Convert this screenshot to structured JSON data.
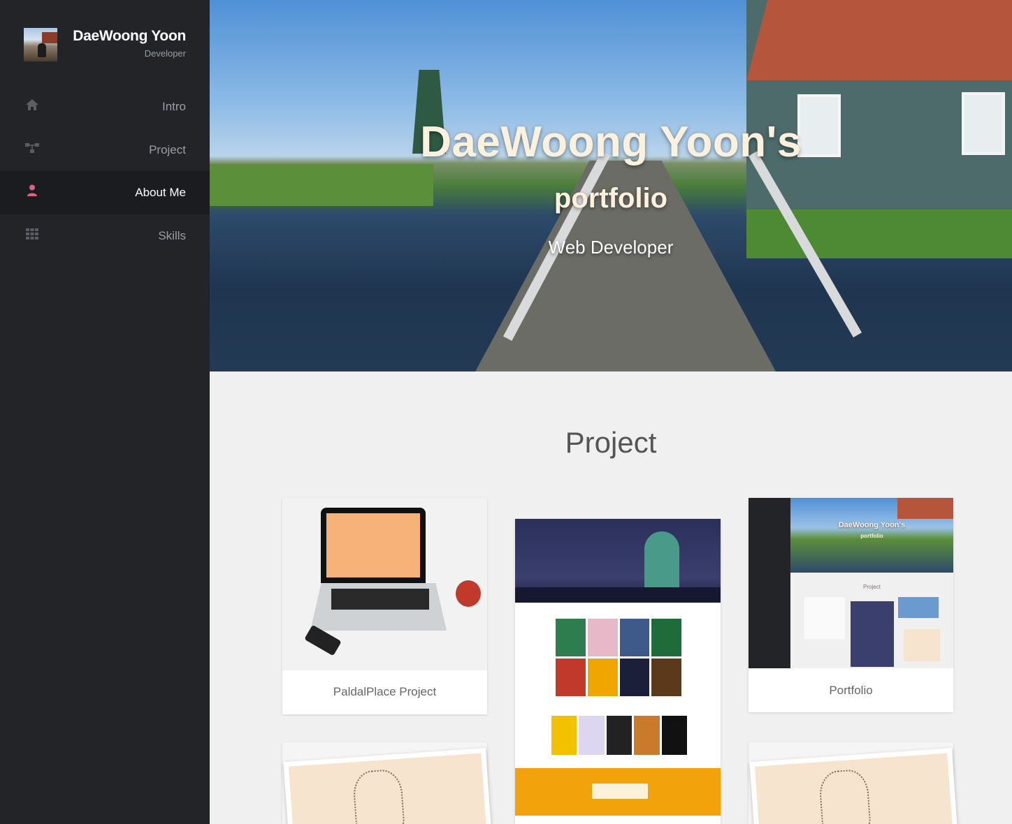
{
  "sidebar": {
    "profile": {
      "name": "DaeWoong Yoon",
      "role": "Developer"
    },
    "items": [
      {
        "label": "Intro",
        "icon": "home-icon",
        "active": false
      },
      {
        "label": "Project",
        "icon": "sitemap-icon",
        "active": false
      },
      {
        "label": "About Me",
        "icon": "user-icon",
        "active": true
      },
      {
        "label": "Skills",
        "icon": "grid-icon",
        "active": false
      }
    ]
  },
  "hero": {
    "title_line1": "DaeWoong Yoon's",
    "title_line2": "portfolio",
    "subtitle": "Web Developer"
  },
  "project": {
    "heading": "Project",
    "cards": [
      {
        "caption": "PaldalPlace Project"
      },
      {
        "caption": ""
      },
      {
        "caption": "Portfolio"
      }
    ],
    "mini_site": {
      "name": "DaeWoong Yoon",
      "title": "DaeWoong Yoon's",
      "subtitle": "portfolio",
      "section": "Project"
    }
  },
  "colors": {
    "sidebar_bg": "#222427",
    "active_icon": "#e0607e",
    "hero_title": "#fbf1dc",
    "page_bg": "#f0f0f0"
  }
}
